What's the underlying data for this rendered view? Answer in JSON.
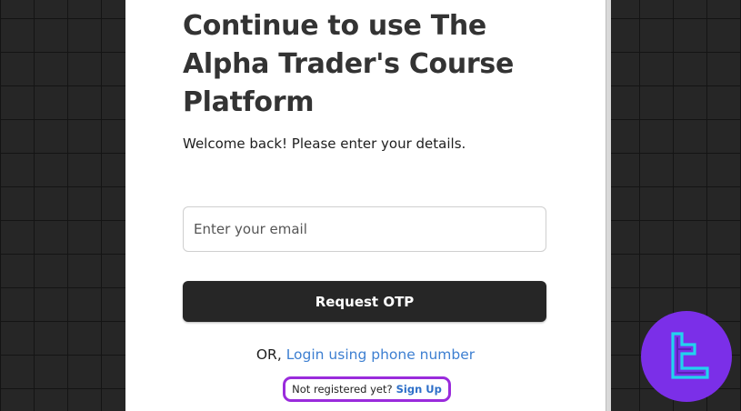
{
  "login": {
    "title": "Continue to use The Alpha Trader's Course Platform",
    "subtitle": "Welcome back! Please enter your details.",
    "email_placeholder": "Enter your email",
    "otp_button_label": "Request OTP",
    "or_label": "OR,",
    "phone_login_link": "Login using phone number",
    "not_registered_label": "Not registered yet?",
    "signup_link": "Sign Up"
  },
  "colors": {
    "background": "#262626",
    "button": "#262626",
    "link": "#3d7fd1",
    "highlight_outline": "#9a2bdc",
    "logo_badge": "#7b2fe8",
    "logo_mark": "#22d3ee"
  },
  "icons": {
    "logo": "tradingfinder-logo-icon"
  }
}
